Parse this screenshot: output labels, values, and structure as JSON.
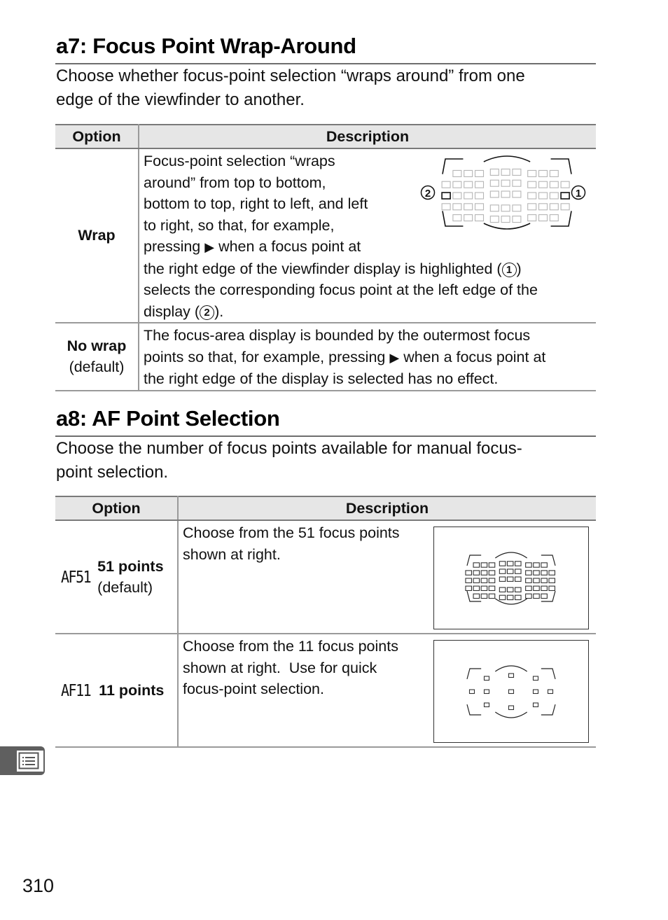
{
  "page_number": "310",
  "side_tab": {
    "icon": "menu-list-icon"
  },
  "sections": [
    {
      "heading": "a7: Focus Point Wrap-Around",
      "intro_line1": "Choose whether focus-point selection “wraps around” from one",
      "intro_line2": "edge of the viewfinder to another.",
      "table": {
        "headers": [
          "Option",
          "Description"
        ],
        "rows": [
          {
            "option": "Wrap",
            "option_note": "",
            "description_lines": [
              "Focus-point selection “wraps",
              "around” from top to bottom,",
              "bottom to top, right to left, and left",
              "to right, so that, for example,",
              "pressing",
              "when a focus point at",
              "the right edge of the viewfinder display is highlighted (",
              ")",
              "selects the corresponding focus point at the left edge of the",
              "display (",
              ")."
            ],
            "arrow_glyph": "▶",
            "callout_1": "1",
            "callout_2": "2",
            "figure": {
              "type": "viewfinder-51",
              "highlight_right": "1",
              "highlight_left": "2"
            }
          },
          {
            "option": "No wrap",
            "option_note": "(default)",
            "description_lines": [
              "The focus-area display is bounded by the outermost focus",
              "points so that, for example, pressing",
              "when a focus point at",
              "the right edge of the display is selected has no effect."
            ],
            "arrow_glyph": "▶"
          }
        ]
      }
    },
    {
      "heading": "a8: AF Point Selection",
      "intro_line1": "Choose the number of focus points available for manual focus-",
      "intro_line2": "point selection.",
      "table": {
        "headers": [
          "Option",
          "Description"
        ],
        "rows": [
          {
            "code": "AF51",
            "option": "51 points",
            "option_note": "(default)",
            "description_lines": [
              "Choose from the 51 focus points",
              "shown at right."
            ],
            "figure": {
              "type": "viewfinder-51",
              "points": 51
            }
          },
          {
            "code": "AF11",
            "option": "11 points",
            "option_note": "",
            "description_lines": [
              "Choose from the 11 focus points",
              "shown at right.  Use for quick",
              "focus-point selection."
            ],
            "figure": {
              "type": "viewfinder-11",
              "points": 11
            }
          }
        ]
      }
    }
  ]
}
